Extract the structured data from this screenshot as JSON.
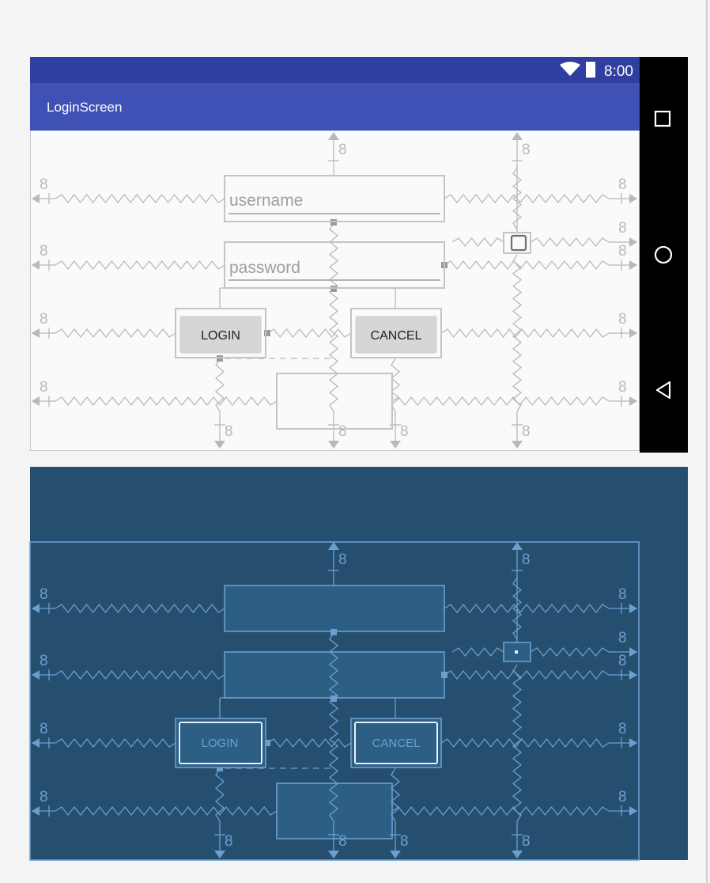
{
  "design_view": {
    "status_bar": {
      "time": "8:00"
    },
    "app_bar": {
      "title": "LoginScreen"
    },
    "form": {
      "username_placeholder": "username",
      "password_placeholder": "password",
      "login_label": "LOGIN",
      "cancel_label": "CANCEL"
    },
    "margin_label": "8"
  },
  "nav_bar": {
    "icons": [
      "recents-square-icon",
      "home-circle-icon",
      "back-triangle-icon"
    ]
  },
  "blueprint_view": {
    "login_label": "LOGIN",
    "cancel_label": "CANCEL",
    "margin_label": "8"
  },
  "colors": {
    "status_bar": "#303f9f",
    "app_bar": "#3f51b5",
    "blueprint_bg": "#264f6f",
    "blueprint_line": "#6a9fd0",
    "constraint_gray": "#b9b9b9"
  }
}
